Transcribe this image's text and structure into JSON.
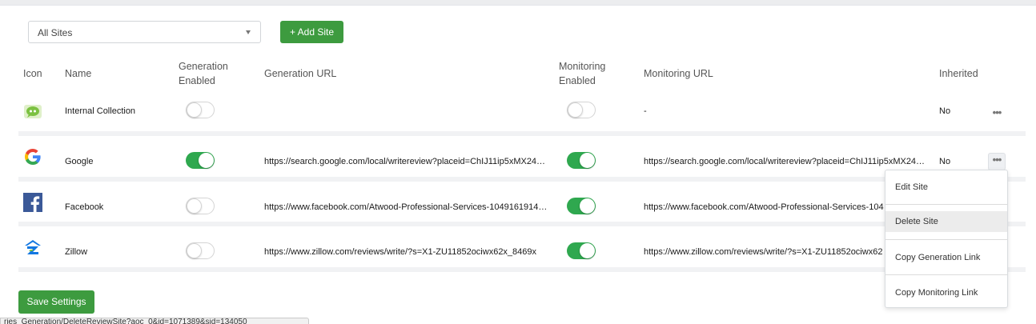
{
  "filter": {
    "selected": "All Sites"
  },
  "add_site_label": "+ Add Site",
  "save_label": "Save Settings",
  "columns": {
    "icon": "Icon",
    "name": "Name",
    "gen_enabled_1": "Generation",
    "gen_enabled_2": "Enabled",
    "gen_url": "Generation URL",
    "mon_enabled_1": "Monitoring",
    "mon_enabled_2": "Enabled",
    "mon_url": "Monitoring URL",
    "inherited": "Inherited"
  },
  "rows": [
    {
      "name": "Internal Collection",
      "icon": "chat-bubble-icon",
      "gen_enabled": false,
      "gen_url": "",
      "mon_enabled": false,
      "mon_url": "-",
      "inherited": "No"
    },
    {
      "name": "Google",
      "icon": "google-icon",
      "gen_enabled": true,
      "gen_url": "https://search.google.com/local/writereview?placeid=ChIJ11ip5xMX24…",
      "mon_enabled": true,
      "mon_url": "https://search.google.com/local/writereview?placeid=ChIJ11ip5xMX24…",
      "inherited": "No"
    },
    {
      "name": "Facebook",
      "icon": "facebook-icon",
      "gen_enabled": false,
      "gen_url": "https://www.facebook.com/Atwood-Professional-Services-1049161914…",
      "mon_enabled": true,
      "mon_url": "https://www.facebook.com/Atwood-Professional-Services-104",
      "inherited": ""
    },
    {
      "name": "Zillow",
      "icon": "zillow-icon",
      "gen_enabled": false,
      "gen_url": "https://www.zillow.com/reviews/write/?s=X1-ZU11852ociwx62x_8469x",
      "mon_enabled": true,
      "mon_url": "https://www.zillow.com/reviews/write/?s=X1-ZU11852ociwx62",
      "inherited": ""
    }
  ],
  "context_menu": {
    "items": [
      "Edit Site",
      "Delete Site",
      "Copy Generation Link",
      "Copy Monitoring Link"
    ],
    "hovered": "Delete Site"
  },
  "status_bar": "ries_Generation/DeleteReviewSite?aoc_0&id=1071389&sid=134050",
  "colors": {
    "green": "#3d9b3f",
    "toggle_on": "#2fa84f"
  }
}
